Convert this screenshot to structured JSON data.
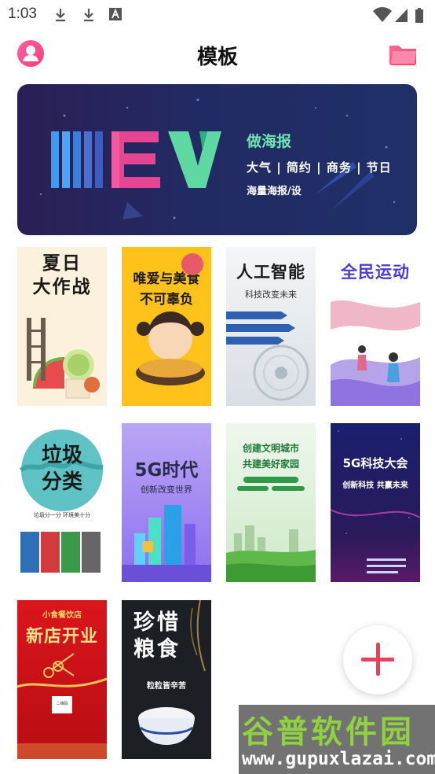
{
  "status_bar": {
    "time": "1:03"
  },
  "header": {
    "title": "模板"
  },
  "banner": {
    "logo": "NEW",
    "line1": "做海报",
    "line2": "大气 | 简约 | 商务 | 节日",
    "line3": "海量海报/设"
  },
  "templates": [
    {
      "title": "夏日\n大作战"
    },
    {
      "title": "唯爱与美食\n不可辜负"
    },
    {
      "title": "人工智能",
      "subtitle": "科技改变未来"
    },
    {
      "title": "全民运动"
    },
    {
      "title": "垃圾\n分类",
      "subtitle": "垃圾分一分 环境美十分"
    },
    {
      "title": "5G时代",
      "subtitle": "创新改变世界"
    },
    {
      "title": "创建文明城市\n共建美好家园"
    },
    {
      "title": "5G科技大会",
      "subtitle": "创新科技 共赢未来"
    },
    {
      "title": "新店开业",
      "subtitle": "小食餐饮店",
      "badge": "二维码"
    },
    {
      "title": "珍惜\n粮食",
      "subtitle": "粒粒皆辛苦"
    }
  ],
  "watermark": {
    "cn": "谷普软件园",
    "url": "www.gupuxlazai.com"
  },
  "colors": {
    "accent": "#ef3e5c",
    "avatar": "#ff4f8f",
    "banner_bg": "#252a62"
  }
}
